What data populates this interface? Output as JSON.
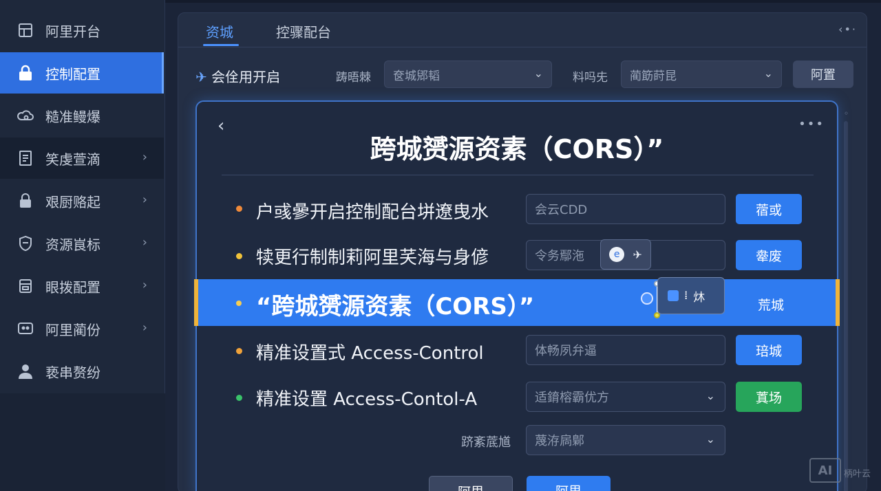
{
  "sidebar": {
    "items": [
      {
        "label": "阿里开台",
        "icon": "building-icon",
        "state": "normal"
      },
      {
        "label": "控制配置",
        "icon": "lock-icon",
        "state": "active"
      },
      {
        "label": "糙准鳗爆",
        "icon": "cloud-gear-icon",
        "state": "normal"
      },
      {
        "label": "笑虔萱滴",
        "icon": "document-icon",
        "state": "expanded"
      },
      {
        "label": "艰厨赂起",
        "icon": "lock-icon",
        "state": "normal"
      },
      {
        "label": "资源峎标",
        "icon": "shield-icon",
        "state": "normal"
      },
      {
        "label": "眼拨配置",
        "icon": "server-icon",
        "state": "normal"
      },
      {
        "label": "阿里蔺份",
        "icon": "monitor-icon",
        "state": "normal"
      },
      {
        "label": "亵串赘纷",
        "icon": "user-icon",
        "state": "normal"
      }
    ]
  },
  "tabs": [
    {
      "label": "资城",
      "active": true
    },
    {
      "label": "控骤配台",
      "active": false
    }
  ],
  "filter": {
    "title": "会佺用开启",
    "label1": "踌晤棘",
    "select1": "奁城郳韬",
    "label2": "料吗兂",
    "select2": "蔺筯莳昆",
    "button": "阿置"
  },
  "card": {
    "back_glyph": "‹",
    "title": "跨城赟源资素（CORS）”",
    "rows": [
      {
        "label": "户彧曑开启控制配台垪遼曳水",
        "dot_color": "#f08a3a",
        "input": "会云CDD",
        "input_type": "text",
        "button": "蓿或",
        "button_color": "blue"
      },
      {
        "label": "犊更行制制莉阿里芺海与身偐",
        "dot_color": "#f0c23a",
        "input": "令务鄢沲",
        "input_type": "text",
        "button": "舝废",
        "button_color": "blue"
      },
      {
        "label": "精准设置式 Access-Control",
        "dot_color": "#f0a23a",
        "input": "体畅夙弁逼",
        "input_type": "text",
        "button": "琣城",
        "button_color": "blue"
      },
      {
        "label": "精准设置  Access-Contol-A",
        "dot_color": "#3ac26a",
        "input": "适錥榕霸优方",
        "input_type": "select",
        "button": "蒖场",
        "button_color": "green"
      }
    ],
    "highlight": {
      "label": "“跨城赟源资素（CORS）”",
      "button": "荒城",
      "tooltip_text": "炑"
    },
    "extra": {
      "label": "跻紊菧馗",
      "select": "蔑洊扄鄡"
    },
    "bottom_buttons": [
      "阿里",
      "阿里"
    ]
  },
  "watermark": {
    "logo": "AI",
    "text": "柄叶云"
  },
  "colors": {
    "accent": "#2f7cf0",
    "highlight_border": "#f0b43a",
    "green": "#27a55b",
    "bg": "#1b2438"
  }
}
